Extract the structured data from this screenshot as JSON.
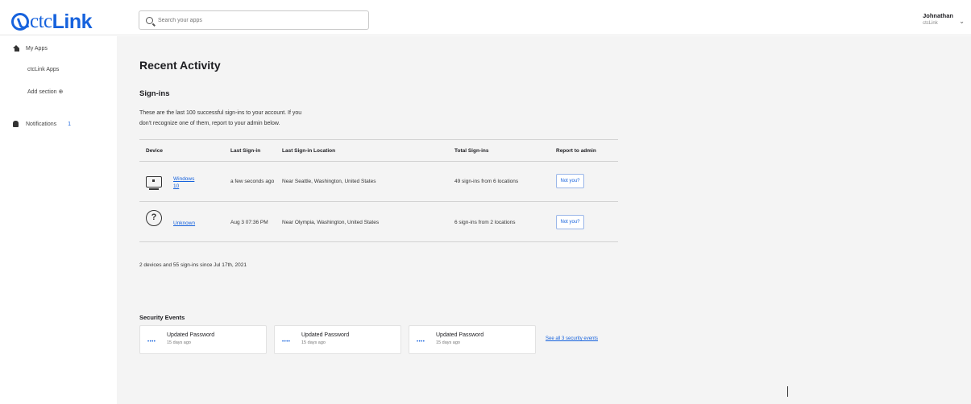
{
  "header": {
    "logo_ctc": "ctc",
    "logo_link": "Link",
    "search_placeholder": "Search your apps",
    "user_name": "Johnathan",
    "user_org": "ctcLink",
    "user_chevron": "⌄"
  },
  "sidebar": {
    "items": [
      {
        "label": "My Apps",
        "icon": "home-icon"
      },
      {
        "label": "ctcLink Apps"
      },
      {
        "label": "Add section ⊕"
      },
      {
        "label": "Notifications",
        "icon": "bell-icon",
        "count": "1"
      }
    ]
  },
  "main": {
    "title": "Recent Activity",
    "signins": {
      "title": "Sign-ins",
      "description_line1": "These are the last 100 successful sign-ins to your account. If you",
      "description_line2": "don't recognize one of them, report to your admin below.",
      "columns": [
        "Device",
        "Last Sign-in",
        "Last Sign-in Location",
        "Total Sign-ins",
        "Report to admin"
      ],
      "rows": [
        {
          "device": "Windows 10",
          "device_line1": "Windows",
          "device_line2": "10",
          "icon": "monitor-icon",
          "last": "a few seconds ago",
          "location": "Near Seattle, Washington, United States",
          "total": "49 sign-ins from 6 locations",
          "action": "Not you?"
        },
        {
          "device": "Unknown",
          "icon": "question-icon",
          "last": "Aug 3 07:36 PM",
          "location": "Near Olympia, Washington, United States",
          "total": "6 sign-ins from 2 locations",
          "action": "Not you?"
        }
      ],
      "summary": "2 devices and 55 sign-ins since Jul 17th, 2021"
    },
    "security": {
      "title": "Security Events",
      "events": [
        {
          "label": "Updated Password",
          "time": "15 days ago",
          "icon": "password-dots-icon",
          "dots": "••••"
        },
        {
          "label": "Updated Password",
          "time": "15 days ago",
          "icon": "password-dots-icon",
          "dots": "••••"
        },
        {
          "label": "Updated Password",
          "time": "15 days ago",
          "icon": "password-dots-icon",
          "dots": "••••"
        }
      ],
      "see_all": "See all 3 security events"
    }
  },
  "colors": {
    "brand": "#1662dd",
    "background": "#f4f4f4"
  }
}
